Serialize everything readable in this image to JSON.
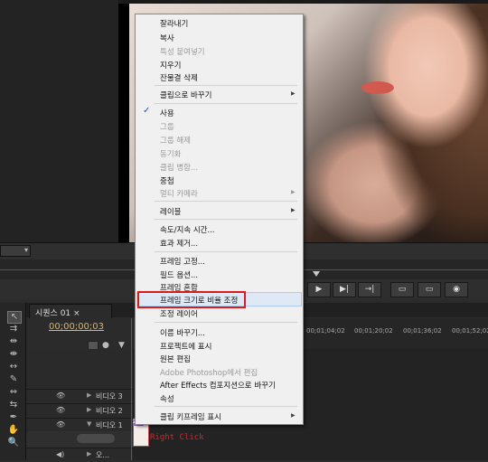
{
  "menu": {
    "items": [
      {
        "label": "잘라내기",
        "enabled": true
      },
      {
        "label": "복사",
        "enabled": true
      },
      {
        "label": "특성 붙여넣기",
        "enabled": false
      },
      {
        "label": "지우기",
        "enabled": true
      },
      {
        "label": "잔물결 삭제",
        "enabled": true
      },
      {
        "label": "클립으로 바꾸기",
        "enabled": true,
        "submenu": true
      },
      {
        "label": "사용",
        "enabled": true,
        "checked": true
      },
      {
        "label": "그룹",
        "enabled": false
      },
      {
        "label": "그룹 해제",
        "enabled": false
      },
      {
        "label": "동기화",
        "enabled": false
      },
      {
        "label": "클립 병합...",
        "enabled": false
      },
      {
        "label": "중첩",
        "enabled": true
      },
      {
        "label": "멀티 카메라",
        "enabled": false,
        "submenu": true
      },
      {
        "label": "레이블",
        "enabled": true,
        "submenu": true
      },
      {
        "label": "속도/지속 시간...",
        "enabled": true
      },
      {
        "label": "효과 제거...",
        "enabled": true
      },
      {
        "label": "프레임 고정...",
        "enabled": true
      },
      {
        "label": "필드 옵션...",
        "enabled": true
      },
      {
        "label": "프레임 혼합",
        "enabled": true
      },
      {
        "label": "프레임 크기로 비율 조정",
        "enabled": true,
        "highlighted": true
      },
      {
        "label": "조정 레이어",
        "enabled": true
      },
      {
        "label": "이름 바꾸기...",
        "enabled": true
      },
      {
        "label": "프로젝트에 표시",
        "enabled": true
      },
      {
        "label": "원본 편집",
        "enabled": true
      },
      {
        "label": "Adobe Photoshop에서 편집",
        "enabled": false
      },
      {
        "label": "After Effects 컴포지션으로 바꾸기",
        "enabled": true
      },
      {
        "label": "속성",
        "enabled": true
      },
      {
        "label": "클립 키프레임 표시",
        "enabled": true,
        "submenu": true
      }
    ]
  },
  "timeline": {
    "tab": "시퀀스 01 ×",
    "timecode": "00;00;00;03",
    "ruler_labels": [
      "00;01;04;02",
      "00;01;20;02",
      "00;01;36;02",
      "00;01;52;02"
    ],
    "tracks": [
      {
        "label": "비디오 3"
      },
      {
        "label": "비디오 2"
      },
      {
        "label": "비디오 1"
      },
      {
        "label": "오..."
      }
    ],
    "clip_badge": "20"
  },
  "annotation": "Right Click",
  "colors": {
    "annotation_red": "#e01a1a",
    "timecode": "#e4b54a",
    "playhead": "#dd2222"
  }
}
